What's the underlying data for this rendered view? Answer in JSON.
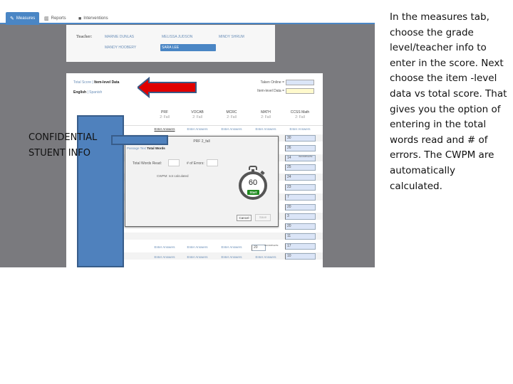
{
  "nav": {
    "tabs": [
      {
        "label": "Measures",
        "icon": "pencil-icon",
        "active": true
      },
      {
        "label": "Reports",
        "icon": "bar-chart-icon",
        "active": false
      },
      {
        "label": "Interventions",
        "icon": "book-icon",
        "active": false
      }
    ]
  },
  "teachers": {
    "label": "Teacher:",
    "items": [
      {
        "name": "MARNIE DUNLAS",
        "selected": false
      },
      {
        "name": "MELISSA JUDSON",
        "selected": false
      },
      {
        "name": "MINDY SHRUM",
        "selected": false
      },
      {
        "name": "MANDY HOOBERY",
        "selected": false
      },
      {
        "name": "SARA LEE",
        "selected": true
      }
    ]
  },
  "score_mode": {
    "total_label": "Total Score",
    "separator": "|",
    "item_label": "Item-level Data",
    "english_label": "English",
    "spanish_label": "Spanish"
  },
  "legend": {
    "taken_online": "Taken Online =",
    "item_level": "Item-level Data =",
    "taken_online_color": "#dbe5f7",
    "item_level_color": "#fffacd"
  },
  "columns": [
    {
      "name": "PRF",
      "sub": "2: Fall"
    },
    {
      "name": "VOCAB",
      "sub": "2: Fall"
    },
    {
      "name": "MCRC",
      "sub": "2: Fall"
    },
    {
      "name": "MATH",
      "sub": "2: Fall"
    },
    {
      "name": "CCSS Math",
      "sub": "2: Fall"
    }
  ],
  "enter_answers_label": "Enter Answers",
  "scores": [
    "30",
    "26",
    "14",
    "25",
    "24",
    "23",
    "7",
    "20",
    "3",
    "20",
    "11",
    "17",
    "10"
  ],
  "incomplete_label": "INCOMPLETE",
  "inline_score": "20",
  "modal": {
    "title": "PRF 2_fall",
    "tab_passage": "Passage Text",
    "tab_total": "Total Words",
    "total_words_label": "Total Words Read:",
    "errors_label": "# of Errors:",
    "cwpm_label": "CWPM:",
    "cwpm_value": "not calculated",
    "timer_value": "60",
    "start_label": "Start",
    "cancel_label": "Cancel",
    "save_label": "Save"
  },
  "redaction_text": [
    "CONFIDENTIAL",
    "STUENT INFO"
  ],
  "caption": "In the measures tab, choose the grade level/teacher info to enter in the score. Next choose the item -level data vs total score.  That gives you the option of entering in the total words read and # of errors.  The CWPM are automatically calculated.",
  "colors": {
    "accent": "#4a86c5",
    "redaction_fill": "#4f81bd",
    "redaction_border": "#385d8a",
    "arrow": "#e00000",
    "start_green": "#1f8a1f"
  }
}
